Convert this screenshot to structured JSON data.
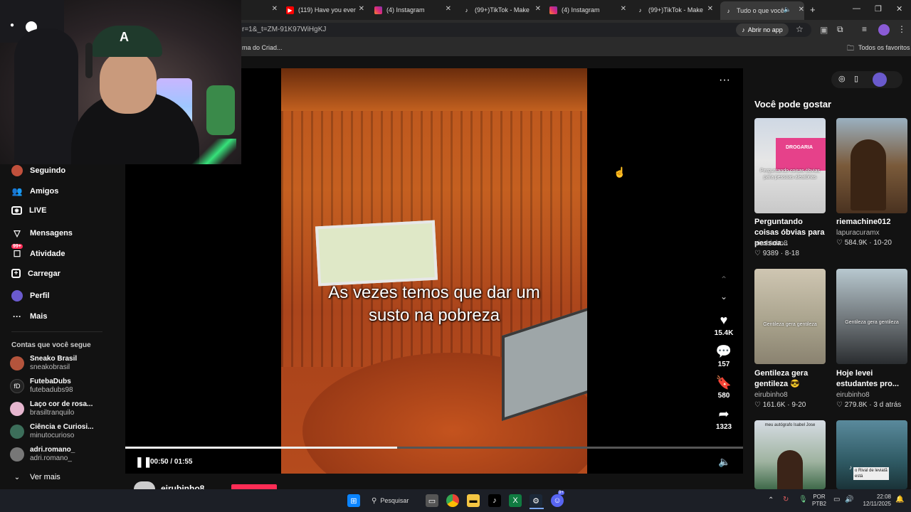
{
  "browser": {
    "tabs": [
      {
        "label": "",
        "icon": "tab-partial",
        "active": false
      },
      {
        "label": "(119) Have you ever",
        "icon": "youtube-icon",
        "active": false
      },
      {
        "label": "(4) Instagram",
        "icon": "instagram-icon",
        "active": false
      },
      {
        "label": "(99+)TikTok - Make",
        "icon": "tiktok-icon",
        "active": false
      },
      {
        "label": "(4) Instagram",
        "icon": "instagram-icon",
        "active": false
      },
      {
        "label": "(99+)TikTok - Make",
        "icon": "tiktok-icon",
        "active": false
      },
      {
        "label": "Tudo o que você",
        "icon": "tiktok-icon",
        "active": true
      }
    ],
    "url_fragment": "r=1&_t=ZM-91K97WiHgKJ",
    "open_app_label": "Abrir no app",
    "bookmarks": {
      "left_fragment": "ma do Criad...",
      "all_bookmarks": "Todos os favoritos"
    }
  },
  "sidebar": {
    "nav": [
      {
        "label": "Seguindo",
        "icon": "avatar-icon"
      },
      {
        "label": "Amigos",
        "icon": "friends-icon"
      },
      {
        "label": "LIVE",
        "icon": "live-icon"
      },
      {
        "label": "Mensagens",
        "icon": "send-icon"
      },
      {
        "label": "Atividade",
        "icon": "activity-icon",
        "badge": "99+"
      },
      {
        "label": "Carregar",
        "icon": "upload-icon"
      },
      {
        "label": "Perfil",
        "icon": "profile-icon"
      },
      {
        "label": "Mais",
        "icon": "more-icon"
      }
    ],
    "following_heading": "Contas que você segue",
    "accounts": [
      {
        "name": "Sneako Brasil",
        "handle": "sneakobrasil",
        "color": "#b4543c"
      },
      {
        "name": "FutebaDubs",
        "handle": "futebadubs98",
        "color": "#222222"
      },
      {
        "name": "Laço cor de rosa...",
        "handle": "brasiltranquilo",
        "color": "#e6b6cf"
      },
      {
        "name": "Ciência e Curiosi...",
        "handle": "minutocurioso",
        "color": "#3c6e5a"
      },
      {
        "name": "adri.romano_",
        "handle": "adri.romano_",
        "color": "#777777"
      }
    ],
    "see_more": "Ver mais"
  },
  "video": {
    "caption_line1": "As vezes temos que dar um",
    "caption_line2": "susto na pobreza",
    "time": "00:50 / 01:55",
    "progress": 0.44,
    "author_fragment": "eirubinho8",
    "actions": {
      "likes": "15.4K",
      "comments": "157",
      "saves": "580",
      "shares": "1323"
    }
  },
  "recommended": {
    "heading": "Você pode gostar",
    "cards": [
      {
        "title": "Perguntando coisas óbvias para pessoa...",
        "author": "eirubinho8",
        "likes": "9389",
        "date": "8-18",
        "overlay": "Perguntando coisas óbvias para pessoas aleatórias",
        "sign": "DROGARIA"
      },
      {
        "title": "riemachine012",
        "author": "lapuracuramx",
        "likes": "584.9K",
        "date": "10-20"
      },
      {
        "title": "Gentileza gera gentileza 😎",
        "author": "eirubinho8",
        "likes": "161.6K",
        "date": "9-20",
        "overlay": "Gentileza gera gentileza"
      },
      {
        "title": "Hoje levei estudantes pro...",
        "author": "eirubinho8",
        "likes": "279.8K",
        "date": "3 d atrás",
        "overlay": "Gentileza gera gentileza"
      },
      {
        "overlay": "meu autógrafo Isabel Jose"
      },
      {
        "overlay": "o Rival de leviatã está"
      }
    ]
  },
  "taskbar": {
    "search_label": "Pesquisar",
    "lang": "POR",
    "layout": "PTB2",
    "time": "22:08",
    "date": "12/11/2025",
    "discord_badge": "9+"
  }
}
